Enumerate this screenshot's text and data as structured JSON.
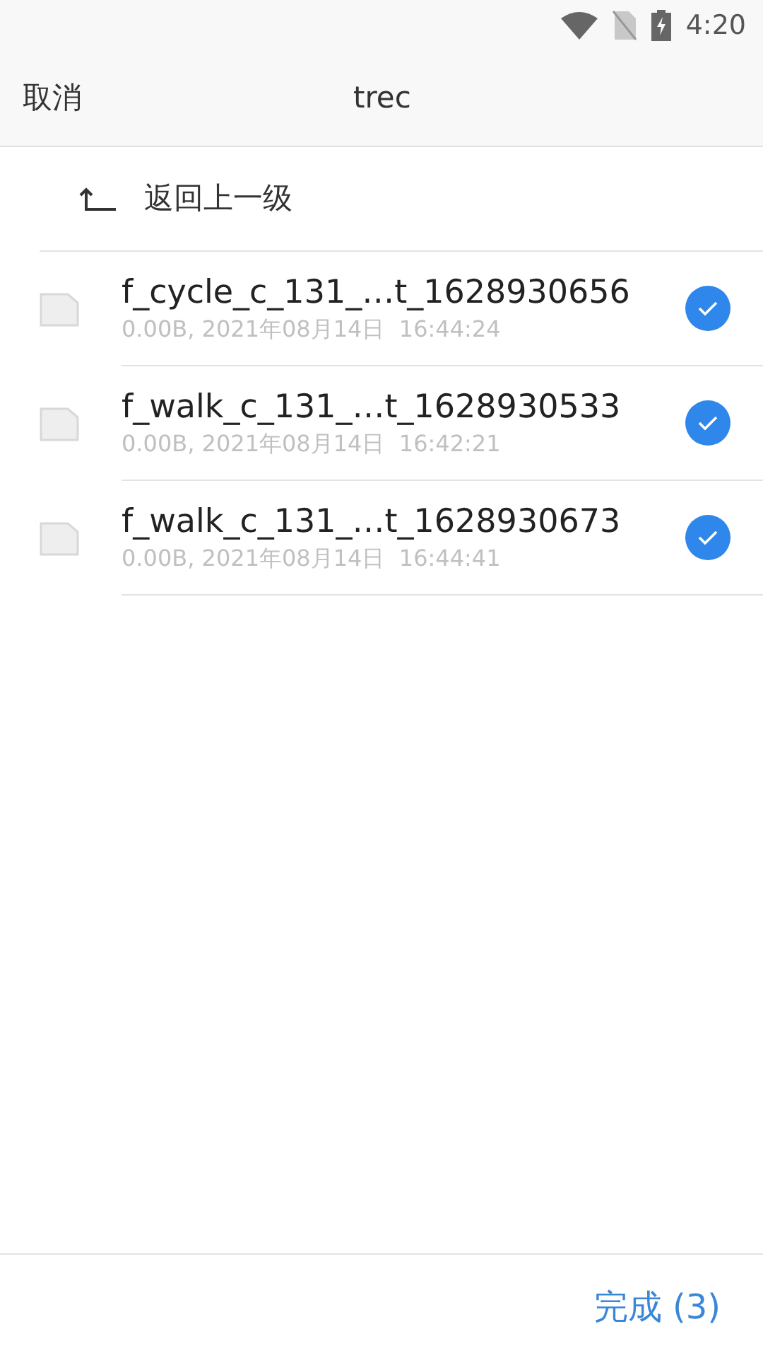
{
  "status_bar": {
    "time": "4:20"
  },
  "header": {
    "cancel": "取消",
    "title": "trec"
  },
  "back": {
    "label": "返回上一级"
  },
  "files": [
    {
      "name": "f_cycle_c_131_…t_1628930656",
      "meta": "0.00B, 2021年08月14日  16:44:24",
      "selected": true
    },
    {
      "name": "f_walk_c_131_…t_1628930533",
      "meta": "0.00B, 2021年08月14日  16:42:21",
      "selected": true
    },
    {
      "name": "f_walk_c_131_…t_1628930673",
      "meta": "0.00B, 2021年08月14日  16:44:41",
      "selected": true
    }
  ],
  "footer": {
    "done": "完成 (3)"
  }
}
